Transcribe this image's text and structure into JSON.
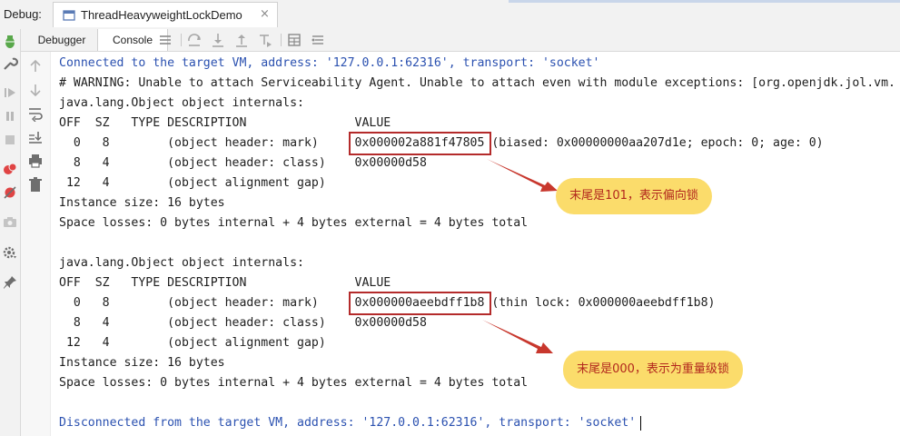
{
  "debug_label": "Debug:",
  "run_tab": {
    "label": "ThreadHeavyweightLockDemo",
    "close": "×"
  },
  "subtabs": {
    "debugger": "Debugger",
    "console": "Console"
  },
  "console_lines": {
    "l0": "Connected to the target VM, address: '127.0.0.1:62316', transport: 'socket'",
    "l1": "# WARNING: Unable to attach Serviceability Agent. Unable to attach even with module exceptions: [org.openjdk.jol.vm.",
    "l2": "java.lang.Object object internals:",
    "l3": "OFF  SZ   TYPE DESCRIPTION               VALUE",
    "l4": "  0   8        (object header: mark)     0x000002a881f47805 (biased: 0x00000000aa207d1e; epoch: 0; age: 0)",
    "l5": "  8   4        (object header: class)    0x00000d58",
    "l6": " 12   4        (object alignment gap)",
    "l7": "Instance size: 16 bytes",
    "l8": "Space losses: 0 bytes internal + 4 bytes external = 4 bytes total",
    "l10": "java.lang.Object object internals:",
    "l11": "OFF  SZ   TYPE DESCRIPTION               VALUE",
    "l12": "  0   8        (object header: mark)     0x000000aeebdff1b8 (thin lock: 0x000000aeebdff1b8)",
    "l13": "  8   4        (object header: class)    0x00000d58",
    "l14": " 12   4        (object alignment gap)",
    "l15": "Instance size: 16 bytes",
    "l16": "Space losses: 0 bytes internal + 4 bytes external = 4 bytes total",
    "l18": "Disconnected from the target VM, address: '127.0.0.1:62316', transport: 'socket'"
  },
  "callouts": {
    "first": "末尾是101，表示偏向锁",
    "second": "末尾是000，表示为重量级锁"
  },
  "colors": {
    "annotation_box": "#b42b2b",
    "callout_bg": "#fbdc6b",
    "callout_text": "#b2271d",
    "vm_message": "#2b51b0"
  }
}
